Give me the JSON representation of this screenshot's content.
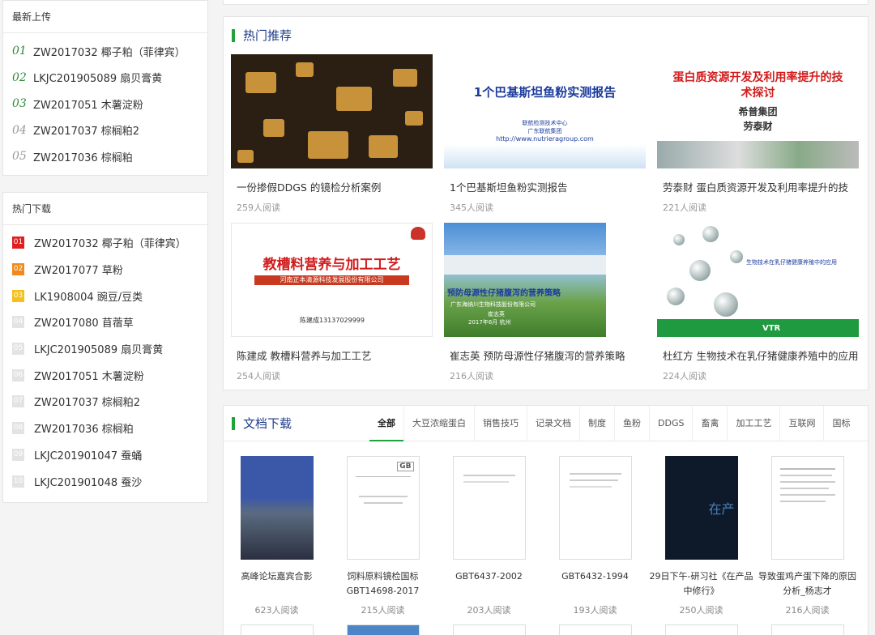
{
  "latest": {
    "title": "最新上传",
    "items": [
      {
        "idx": "01",
        "text": "ZW2017032 椰子粕（菲律宾）"
      },
      {
        "idx": "02",
        "text": "LKJC201905089 扇贝膏黄"
      },
      {
        "idx": "03",
        "text": "ZW2017051 木薯淀粉"
      },
      {
        "idx": "04",
        "text": "ZW2017037 棕榈粕2"
      },
      {
        "idx": "05",
        "text": "ZW2017036 棕榈粕"
      }
    ]
  },
  "hot_download": {
    "title": "热门下载",
    "items": [
      {
        "rank": "01",
        "text": "ZW2017032 椰子粕（菲律宾）",
        "color": "#e02020"
      },
      {
        "rank": "02",
        "text": "ZW2017077 草粉",
        "color": "#f08a1c"
      },
      {
        "rank": "03",
        "text": "LK1908004 豌豆/豆类",
        "color": "#f5c01c"
      },
      {
        "rank": "04",
        "text": "ZW2017080 苜蓿草",
        "color": "#e3e3e3"
      },
      {
        "rank": "05",
        "text": "LKJC201905089 扇贝膏黄",
        "color": "#e3e3e3"
      },
      {
        "rank": "06",
        "text": "ZW2017051 木薯淀粉",
        "color": "#e3e3e3"
      },
      {
        "rank": "07",
        "text": "ZW2017037 棕榈粕2",
        "color": "#e3e3e3"
      },
      {
        "rank": "08",
        "text": "ZW2017036 棕榈粕",
        "color": "#e3e3e3"
      },
      {
        "rank": "09",
        "text": "LKJC201901047 蚕蛹",
        "color": "#e3e3e3"
      },
      {
        "rank": "10",
        "text": "LKJC201901048 蚕沙",
        "color": "#e3e3e3"
      }
    ]
  },
  "recommend": {
    "title": "热门推荐",
    "cards": [
      {
        "title": "一份掺假DDGS 的镜检分析案例",
        "reads": "259人阅读"
      },
      {
        "title": "1个巴基斯坦鱼粉实测报告",
        "reads": "345人阅读",
        "thumb_heading": "1个巴基斯坦鱼粉实测报告",
        "thumb_line1": "联航检测技术中心",
        "thumb_line2": "广东联航集团",
        "thumb_url": "http://www.nutrieragroup.com"
      },
      {
        "title": "劳泰财 蛋白质资源开发及利用率提升的技",
        "reads": "221人阅读",
        "thumb_heading": "蛋白质资源开发及利用率提升的技术探讨",
        "thumb_org": "希普集团",
        "thumb_author": "劳泰财"
      },
      {
        "title": "陈建成 教槽料营养与加工工艺",
        "reads": "254人阅读",
        "thumb_heading": "教槽料营养与加工工艺",
        "thumb_band": "河南正本清源科技发展股份有限公司",
        "thumb_author": "陈建成13137029999"
      },
      {
        "title": "崔志英 预防母源性仔猪腹泻的营养策略",
        "reads": "216人阅读",
        "thumb_heading": "预防母源性仔猪腹泻的营养策略",
        "thumb_org": "广东海纳川生物科技股份有限公司",
        "thumb_author": "崔志英",
        "thumb_date": "2017年6月  杭州"
      },
      {
        "title": "杜红方 生物技术在乳仔猪健康养殖中的应用",
        "reads": "224人阅读",
        "thumb_heading": "生物技术在乳仔猪健康养殖中的应用",
        "thumb_logo": "VTR"
      }
    ]
  },
  "documents": {
    "title": "文档下载",
    "tabs": [
      "全部",
      "大豆浓缩蛋白",
      "销售技巧",
      "记录文档",
      "制度",
      "鱼粉",
      "DDGS",
      "畜禽",
      "加工工艺",
      "互联网",
      "国标"
    ],
    "items": [
      {
        "title": "高峰论坛嘉宾合影",
        "reads": "623人阅读"
      },
      {
        "title": "饲料原料镜检国标GBT14698-2017",
        "reads": "215人阅读",
        "thumb_badge": "GB"
      },
      {
        "title": "GBT6437-2002",
        "reads": "203人阅读"
      },
      {
        "title": "GBT6432-1994",
        "reads": "193人阅读"
      },
      {
        "title": "29日下午-研习社《在产品中修行》",
        "reads": "250人阅读",
        "thumb_text": "在产"
      },
      {
        "title": "导致蛋鸡产蛋下降的原因分析_杨志才",
        "reads": "216人阅读"
      }
    ]
  }
}
